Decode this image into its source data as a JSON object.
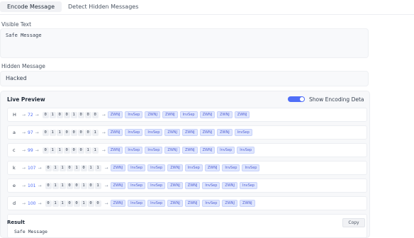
{
  "tabs": [
    {
      "label": "Encode Message",
      "active": true
    },
    {
      "label": "Detect Hidden Messages",
      "active": false
    }
  ],
  "visible_text": {
    "label": "Visible Text",
    "value": "Safe Message"
  },
  "hidden_message": {
    "label": "Hidden Message",
    "value": "Hacked"
  },
  "preview": {
    "title": "Live Preview",
    "toggle_label": "Show Encoding Deta",
    "toggle_on": true,
    "arrow": "→",
    "rows": [
      {
        "char": "H",
        "code": "72",
        "bits": [
          "0",
          "1",
          "0",
          "0",
          "1",
          "0",
          "0",
          "0"
        ],
        "chips": [
          "ZWNJ",
          "InvSep",
          "ZWNJ",
          "ZWNJ",
          "InvSep",
          "ZWNJ",
          "ZWNJ",
          "ZWNJ"
        ]
      },
      {
        "char": "a",
        "code": "97",
        "bits": [
          "0",
          "1",
          "1",
          "0",
          "0",
          "0",
          "0",
          "1"
        ],
        "chips": [
          "ZWNJ",
          "InvSep",
          "InvSep",
          "ZWNJ",
          "ZWNJ",
          "ZWNJ",
          "ZWNJ",
          "InvSep"
        ]
      },
      {
        "char": "c",
        "code": "99",
        "bits": [
          "0",
          "1",
          "1",
          "0",
          "0",
          "0",
          "1",
          "1"
        ],
        "chips": [
          "ZWNJ",
          "InvSep",
          "InvSep",
          "ZWNJ",
          "ZWNJ",
          "ZWNJ",
          "InvSep",
          "InvSep"
        ]
      },
      {
        "char": "k",
        "code": "107",
        "bits": [
          "0",
          "1",
          "1",
          "0",
          "1",
          "0",
          "1",
          "1"
        ],
        "chips": [
          "ZWNJ",
          "InvSep",
          "InvSep",
          "ZWNJ",
          "InvSep",
          "ZWNJ",
          "InvSep",
          "InvSep"
        ]
      },
      {
        "char": "e",
        "code": "101",
        "bits": [
          "0",
          "1",
          "1",
          "0",
          "0",
          "1",
          "0",
          "1"
        ],
        "chips": [
          "ZWNJ",
          "InvSep",
          "InvSep",
          "ZWNJ",
          "ZWNJ",
          "InvSep",
          "ZWNJ",
          "InvSep"
        ]
      },
      {
        "char": "d",
        "code": "100",
        "bits": [
          "0",
          "1",
          "1",
          "0",
          "0",
          "1",
          "0",
          "0"
        ],
        "chips": [
          "ZWNJ",
          "InvSep",
          "InvSep",
          "ZWNJ",
          "ZWNJ",
          "InvSep",
          "ZWNJ",
          "ZWNJ"
        ]
      }
    ]
  },
  "result": {
    "title": "Result",
    "copy_label": "Copy",
    "value": "Safe Message"
  },
  "colors": {
    "accent": "#4f6ef7",
    "chip_bg": "#dfe6fd"
  }
}
